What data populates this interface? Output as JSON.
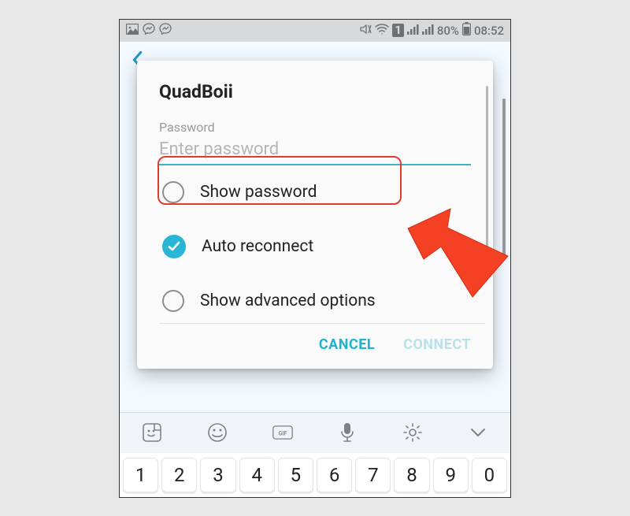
{
  "status_bar": {
    "sim_label": "1",
    "battery_text": "80%",
    "time": "08:52"
  },
  "dialog": {
    "title": "QuadBoii",
    "password_label": "Password",
    "password_placeholder": "Enter password",
    "options": {
      "show_password": "Show password",
      "auto_reconnect": "Auto reconnect",
      "show_advanced": "Show advanced options"
    },
    "cancel": "CANCEL",
    "connect": "CONNECT"
  },
  "keyboard": {
    "numbers": [
      "1",
      "2",
      "3",
      "4",
      "5",
      "6",
      "7",
      "8",
      "9",
      "0"
    ]
  }
}
